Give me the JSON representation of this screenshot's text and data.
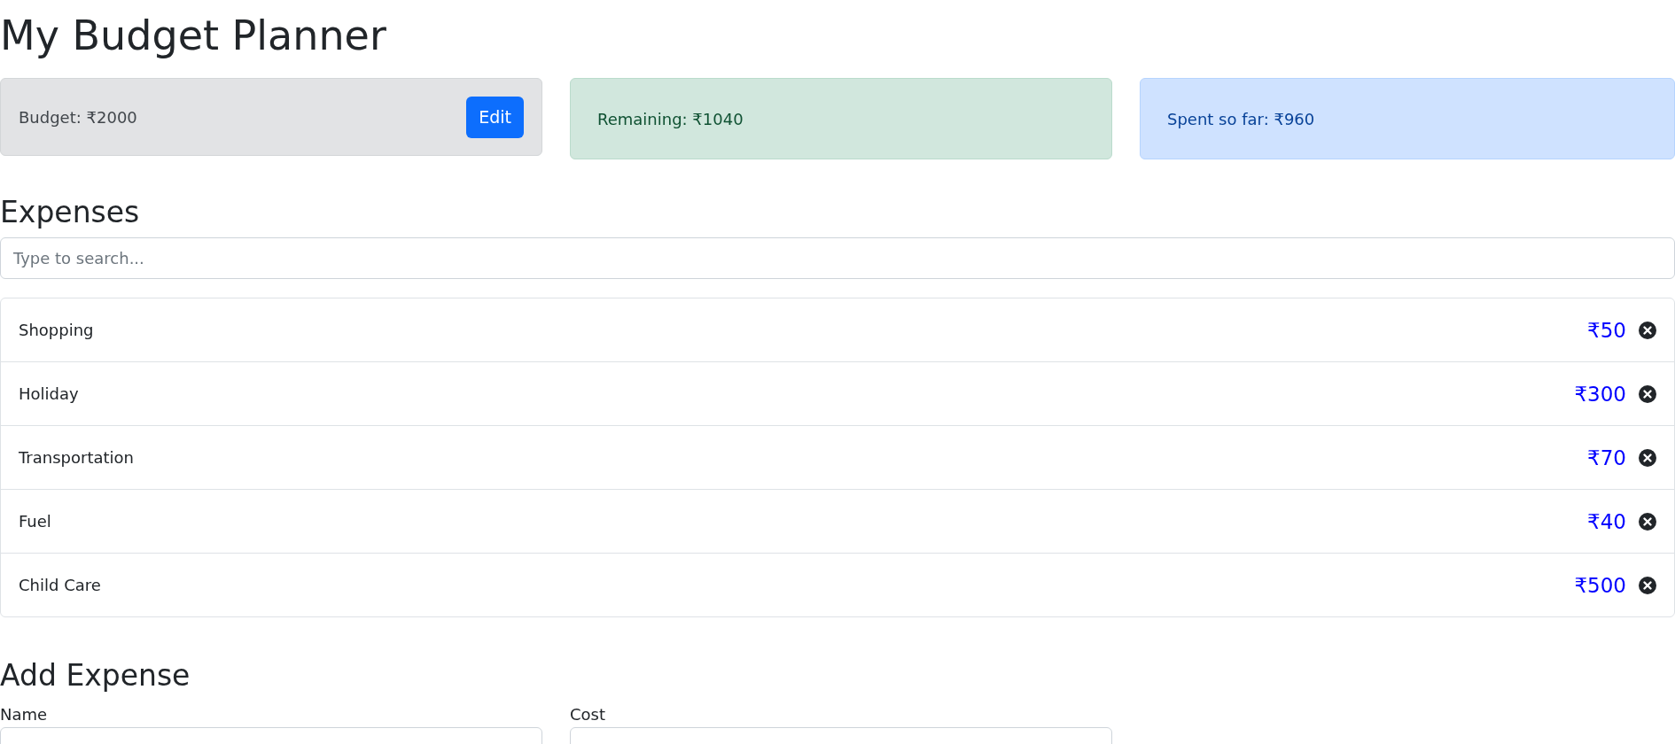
{
  "title": "My Budget Planner",
  "summary": [
    {
      "kind": "budget",
      "label": "Budget: ₹2000",
      "button": "Edit"
    },
    {
      "kind": "remaining",
      "label": "Remaining: ₹1040"
    },
    {
      "kind": "spent",
      "label": "Spent so far: ₹960"
    }
  ],
  "expenses": {
    "title": "Expenses",
    "search": {
      "placeholder": "Type to search..."
    },
    "items": [
      {
        "name": "Shopping",
        "cost": "₹50"
      },
      {
        "name": "Holiday",
        "cost": "₹300"
      },
      {
        "name": "Transportation",
        "cost": "₹70"
      },
      {
        "name": "Fuel",
        "cost": "₹40"
      },
      {
        "name": "Child Care",
        "cost": "₹500"
      }
    ]
  },
  "add_expense": {
    "title": "Add Expense",
    "fields": [
      {
        "label": "Name"
      },
      {
        "label": "Cost"
      }
    ]
  }
}
